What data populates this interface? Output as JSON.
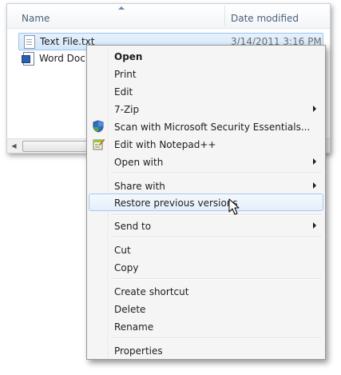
{
  "explorer": {
    "columns": {
      "name": "Name",
      "date_modified": "Date modified"
    },
    "files": [
      {
        "name": "Text File.txt",
        "date": "3/14/2011 3:16 PM",
        "icon": "text-file-icon",
        "selected": true
      },
      {
        "name": "Word Doc -",
        "date": "",
        "icon": "word-document-icon",
        "selected": false
      }
    ]
  },
  "context_menu": {
    "items": [
      {
        "label": "Open",
        "bold": true
      },
      {
        "label": "Print"
      },
      {
        "label": "Edit"
      },
      {
        "label": "7-Zip",
        "submenu": true
      },
      {
        "label": "Scan with Microsoft Security Essentials...",
        "icon": "security-essentials-icon"
      },
      {
        "label": "Edit with Notepad++",
        "icon": "notepad-plus-plus-icon"
      },
      {
        "label": "Open with",
        "submenu": true
      },
      {
        "label": "Share with",
        "submenu": true
      },
      {
        "label": "Restore previous versions",
        "hovered": true
      },
      {
        "label": "Send to",
        "submenu": true
      },
      {
        "label": "Cut"
      },
      {
        "label": "Copy"
      },
      {
        "label": "Create shortcut"
      },
      {
        "label": "Delete"
      },
      {
        "label": "Rename"
      },
      {
        "label": "Properties"
      }
    ]
  },
  "colors": {
    "selection_fill": "#d3e6fa",
    "selection_border": "#9cc3ec",
    "menu_background": "#f5f5f5",
    "menu_border": "#979797"
  }
}
